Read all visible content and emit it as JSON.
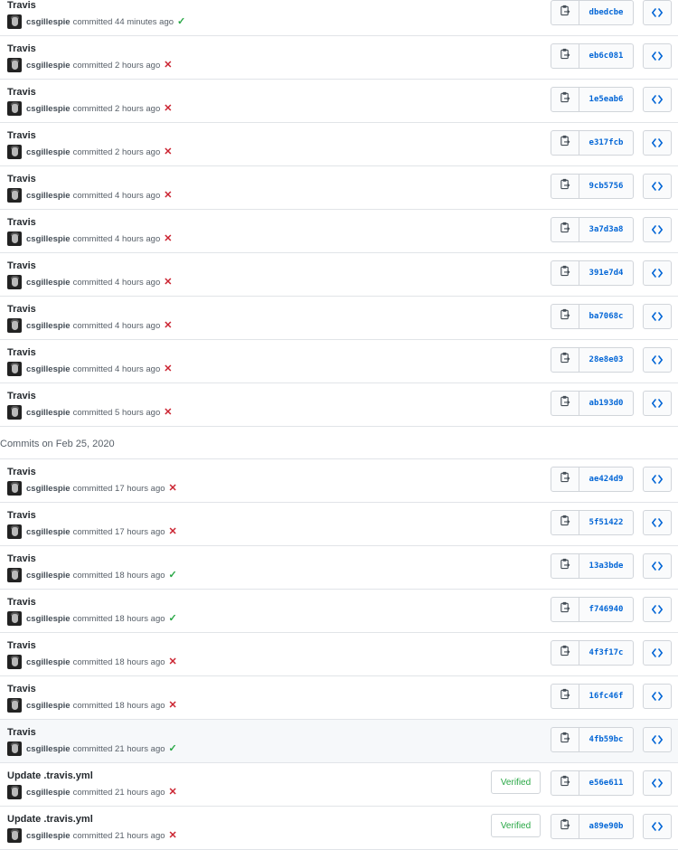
{
  "colors": {
    "link_blue": "#0366d6",
    "success_green": "#28a745",
    "failure_red": "#cb2431",
    "border": "#e1e4e8",
    "highlight_row": "#f6f8fa"
  },
  "icons": {
    "copy": "clippy-icon",
    "browse": "code-brackets-icon",
    "success": "check-icon",
    "failure": "x-icon"
  },
  "groups": [
    {
      "heading": "",
      "commits": [
        {
          "title": "Travis",
          "author": "csgillespie",
          "time": "committed 44 minutes ago",
          "status": "success",
          "status_glyph": "✓",
          "sha": "dbedcbe",
          "verified": ""
        },
        {
          "title": "Travis",
          "author": "csgillespie",
          "time": "committed 2 hours ago",
          "status": "failure",
          "status_glyph": "✕",
          "sha": "eb6c081",
          "verified": ""
        },
        {
          "title": "Travis",
          "author": "csgillespie",
          "time": "committed 2 hours ago",
          "status": "failure",
          "status_glyph": "✕",
          "sha": "1e5eab6",
          "verified": ""
        },
        {
          "title": "Travis",
          "author": "csgillespie",
          "time": "committed 2 hours ago",
          "status": "failure",
          "status_glyph": "✕",
          "sha": "e317fcb",
          "verified": ""
        },
        {
          "title": "Travis",
          "author": "csgillespie",
          "time": "committed 4 hours ago",
          "status": "failure",
          "status_glyph": "✕",
          "sha": "9cb5756",
          "verified": ""
        },
        {
          "title": "Travis",
          "author": "csgillespie",
          "time": "committed 4 hours ago",
          "status": "failure",
          "status_glyph": "✕",
          "sha": "3a7d3a8",
          "verified": ""
        },
        {
          "title": "Travis",
          "author": "csgillespie",
          "time": "committed 4 hours ago",
          "status": "failure",
          "status_glyph": "✕",
          "sha": "391e7d4",
          "verified": ""
        },
        {
          "title": "Travis",
          "author": "csgillespie",
          "time": "committed 4 hours ago",
          "status": "failure",
          "status_glyph": "✕",
          "sha": "ba7068c",
          "verified": ""
        },
        {
          "title": "Travis",
          "author": "csgillespie",
          "time": "committed 4 hours ago",
          "status": "failure",
          "status_glyph": "✕",
          "sha": "28e8e03",
          "verified": ""
        },
        {
          "title": "Travis",
          "author": "csgillespie",
          "time": "committed 5 hours ago",
          "status": "failure",
          "status_glyph": "✕",
          "sha": "ab193d0",
          "verified": ""
        }
      ]
    },
    {
      "heading": "Commits on Feb 25, 2020",
      "commits": [
        {
          "title": "Travis",
          "author": "csgillespie",
          "time": "committed 17 hours ago",
          "status": "failure",
          "status_glyph": "✕",
          "sha": "ae424d9",
          "verified": ""
        },
        {
          "title": "Travis",
          "author": "csgillespie",
          "time": "committed 17 hours ago",
          "status": "failure",
          "status_glyph": "✕",
          "sha": "5f51422",
          "verified": ""
        },
        {
          "title": "Travis",
          "author": "csgillespie",
          "time": "committed 18 hours ago",
          "status": "success",
          "status_glyph": "✓",
          "sha": "13a3bde",
          "verified": ""
        },
        {
          "title": "Travis",
          "author": "csgillespie",
          "time": "committed 18 hours ago",
          "status": "success",
          "status_glyph": "✓",
          "sha": "f746940",
          "verified": ""
        },
        {
          "title": "Travis",
          "author": "csgillespie",
          "time": "committed 18 hours ago",
          "status": "failure",
          "status_glyph": "✕",
          "sha": "4f3f17c",
          "verified": ""
        },
        {
          "title": "Travis",
          "author": "csgillespie",
          "time": "committed 18 hours ago",
          "status": "failure",
          "status_glyph": "✕",
          "sha": "16fc46f",
          "verified": ""
        },
        {
          "title": "Travis",
          "author": "csgillespie",
          "time": "committed 21 hours ago",
          "status": "success",
          "status_glyph": "✓",
          "sha": "4fb59bc",
          "verified": "",
          "highlighted": true
        },
        {
          "title": "Update .travis.yml",
          "author": "csgillespie",
          "time": "committed 21 hours ago",
          "status": "failure",
          "status_glyph": "✕",
          "sha": "e56e611",
          "verified": "Verified"
        },
        {
          "title": "Update .travis.yml",
          "author": "csgillespie",
          "time": "committed 21 hours ago",
          "status": "failure",
          "status_glyph": "✕",
          "sha": "a89e90b",
          "verified": "Verified"
        }
      ]
    }
  ]
}
